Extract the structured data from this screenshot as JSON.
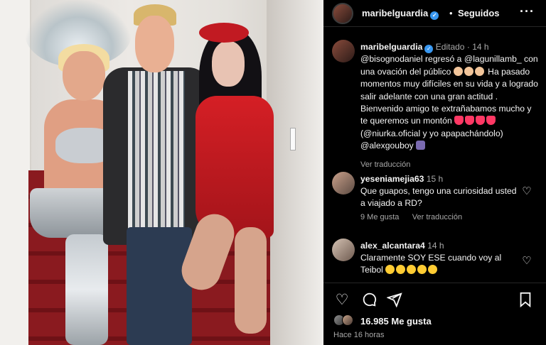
{
  "post": {
    "username": "maribelguardia",
    "separator": "•",
    "follow_status": "Seguidos",
    "more": "•••"
  },
  "caption": {
    "username": "maribelguardia",
    "edited": "Editado",
    "time_dot": "·",
    "time": "14 h",
    "body": "@bisognodaniel regresó a @lagunillamb_ con una ovación del público",
    "body2": "Ha pasado momentos muy difíciles en su vida y a logrado salir adelante con una gran actitud . Bienvenido amigo te extrañabamos mucho y te queremos un montón",
    "body3": "(@niurka.oficial y yo apapachándolo) @alexgouboy",
    "see_translation": "Ver traducción"
  },
  "comments": [
    {
      "username": "yeseniamejia63",
      "time": "15 h",
      "text": "Que guapos, tengo una curiosidad usted a viajado a RD?",
      "likes": "9 Me gusta",
      "see_translation": "Ver traducción"
    },
    {
      "username": "alex_alcantara4",
      "time": "14 h",
      "text": "Claramente SOY ESE cuando voy al Teibol"
    }
  ],
  "actions": {
    "like_icon": "heart-icon",
    "comment_icon": "comment-icon",
    "share_icon": "share-icon",
    "save_icon": "bookmark-icon"
  },
  "likes_count": "16.985 Me gusta",
  "posted": "Hace 16 horas",
  "colors": {
    "background": "#000000",
    "text": "#f5f5f5",
    "muted": "#a8a8a8",
    "verified": "#3897f0"
  }
}
